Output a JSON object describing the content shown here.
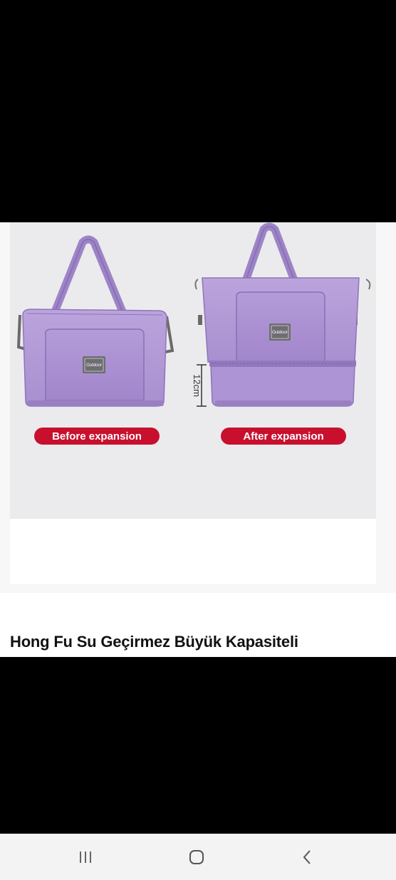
{
  "product": {
    "title": "Hong Fu Su Geçirmez Büyük Kapasiteli",
    "image": {
      "before_label": "Before expansion",
      "after_label": "After expansion",
      "dimension_label": "12cm",
      "brand_patch_text": "Outdoor"
    }
  },
  "nav_bar": {
    "buttons": [
      {
        "name": "recent-apps",
        "icon": "recent-apps-icon"
      },
      {
        "name": "home",
        "icon": "home-icon"
      },
      {
        "name": "back",
        "icon": "back-icon"
      }
    ]
  },
  "colors": {
    "bag_purple": "#b39ad6",
    "bag_purple_dark": "#8e74b8",
    "label_red": "#c8102e",
    "image_bg": "#ebebee",
    "nav_bg": "#f3f3f3"
  }
}
